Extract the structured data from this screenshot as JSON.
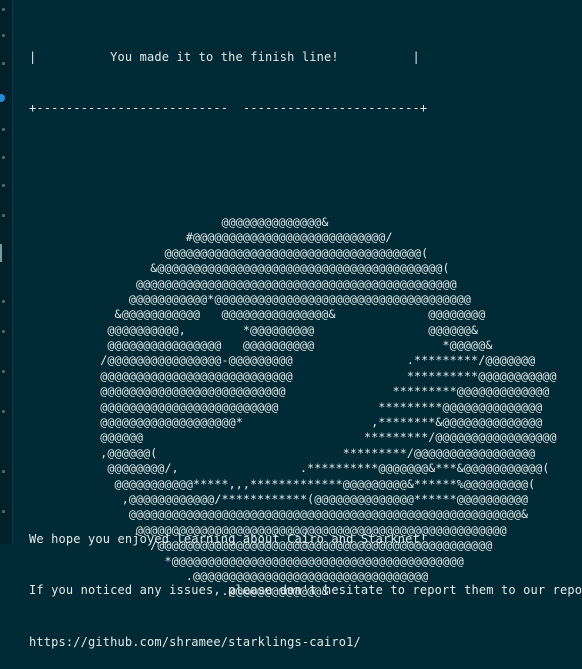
{
  "banner": {
    "title_line": "|          You made it to the finish line!          |",
    "border_line": "+--------------------------  ------------------------+"
  },
  "art": [
    "                           @@@@@@@@@@@@@@&",
    "                      #@@@@@@@@@@@@@@@@@@@@@@@@@@@/",
    "                   @@@@@@@@@@@@@@@@@@@@@@@@@@@@@@@@@@@@(",
    "                 &@@@@@@@@@@@@@@@@@@@@@@@@@@@@@@@@@@@@@@@@(",
    "               @@@@@@@@@@@@@@@@@@@@@@@@@@@@@@@@@@@@@@@@@@@@@",
    "              @@@@@@@@@@@*@@@@@@@@@@@@@@@@@@@@@@@@@@@@@@@@@@@@",
    "            &@@@@@@@@@@@   @@@@@@@@@@@@@@@&             @@@@@@@@",
    "           @@@@@@@@@@,        *@@@@@@@@@                @@@@@@&",
    "           @@@@@@@@@@@@@@@@   @@@@@@@@@@                  *@@@@@&",
    "          /@@@@@@@@@@@@@@@@-@@@@@@@@@                .*********/@@@@@@@",
    "          @@@@@@@@@@@@@@@@@@@@@@@@@@@                **********@@@@@@@@@@@",
    "          @@@@@@@@@@@@@@@@@@@@@@@@@@               *********@@@@@@@@@@@@@",
    "          @@@@@@@@@@@@@@@@@@@@@@@@@              *********@@@@@@@@@@@@@@",
    "          @@@@@@@@@@@@@@@@@@@*                  ,********&@@@@@@@@@@@@@@",
    "          @@@@@@                               *********/@@@@@@@@@@@@@@@@@",
    "          ,@@@@@@(                          *********/@@@@@@@@@@@@@@@@@",
    "           @@@@@@@@/,                 .**********@@@@@@@&***&@@@@@@@@@@@(",
    "            @@@@@@@@@@@*****,,,*************@@@@@@@@@&******%@@@@@@@@@(",
    "             ,@@@@@@@@@@@@/************(@@@@@@@@@@@@@@******@@@@@@@@@@",
    "              @@@@@@@@@@@@@@@@@@@@@@@@@@@@@@@@@@@@@@@@@@@@@@@@@@@@@@@&",
    "               @@@@@@@@@@@@@@@@@@@@@@@@@@@@@@@@@@@@@@@@@@@@@@@@@@@@",
    "                 /@@@@@@@@@@@@@@@@@@@@@@@@@@@@@@@@@@@@@@@@@@@@@@@",
    "                   *@@@@@@@@@@@@@@@@@@@@@@@@@@@@@@@@@@@@@@@@@",
    "                      .@@@@@@@@@@@@@@@@@@@@@@@@@@@@@@@@@",
    "                           .@@@@@@@@@@@@@&"
  ],
  "footer": {
    "line1": "We hope you enjoyed learning about Cairo and Starknet!",
    "line2": "If you noticed any issues, please don't hesitate to report them to our repo.",
    "line3": "https://github.com/shramee/starklings-cairo1/"
  }
}
